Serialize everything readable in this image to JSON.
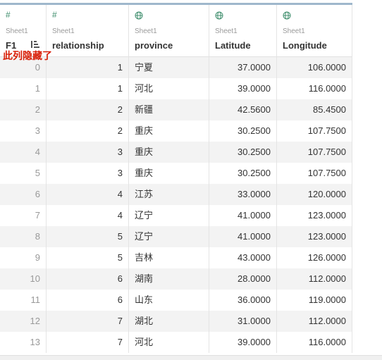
{
  "columns": [
    {
      "icon": "hash-icon",
      "icon_glyph": "#",
      "source": "Sheet1",
      "name": "F1"
    },
    {
      "icon": "hash-icon",
      "icon_glyph": "#",
      "source": "Sheet1",
      "name": "relationship"
    },
    {
      "icon": "globe-icon",
      "source": "Sheet1",
      "name": "province"
    },
    {
      "icon": "globe-icon",
      "source": "Sheet1",
      "name": "Latitude"
    },
    {
      "icon": "globe-icon",
      "source": "Sheet1",
      "name": "Longitude"
    }
  ],
  "annotation": "此列隐藏了",
  "rows": [
    [
      "0",
      "1",
      "宁夏",
      "37.0000",
      "106.0000"
    ],
    [
      "1",
      "1",
      "河北",
      "39.0000",
      "116.0000"
    ],
    [
      "2",
      "2",
      "新疆",
      "42.5600",
      "85.4500"
    ],
    [
      "3",
      "2",
      "重庆",
      "30.2500",
      "107.7500"
    ],
    [
      "4",
      "3",
      "重庆",
      "30.2500",
      "107.7500"
    ],
    [
      "5",
      "3",
      "重庆",
      "30.2500",
      "107.7500"
    ],
    [
      "6",
      "4",
      "江苏",
      "33.0000",
      "120.0000"
    ],
    [
      "7",
      "4",
      "辽宁",
      "41.0000",
      "123.0000"
    ],
    [
      "8",
      "5",
      "辽宁",
      "41.0000",
      "123.0000"
    ],
    [
      "9",
      "5",
      "吉林",
      "43.0000",
      "126.0000"
    ],
    [
      "10",
      "6",
      "湖南",
      "28.0000",
      "112.0000"
    ],
    [
      "11",
      "6",
      "山东",
      "36.0000",
      "119.0000"
    ],
    [
      "12",
      "7",
      "湖北",
      "31.0000",
      "112.0000"
    ],
    [
      "13",
      "7",
      "河北",
      "39.0000",
      "116.0000"
    ]
  ],
  "colors": {
    "accent_bar": "#9fb7cc",
    "icon_green": "#3f8e6d",
    "annotation_red": "#d81e06",
    "row_alt": "#f3f3f3"
  }
}
